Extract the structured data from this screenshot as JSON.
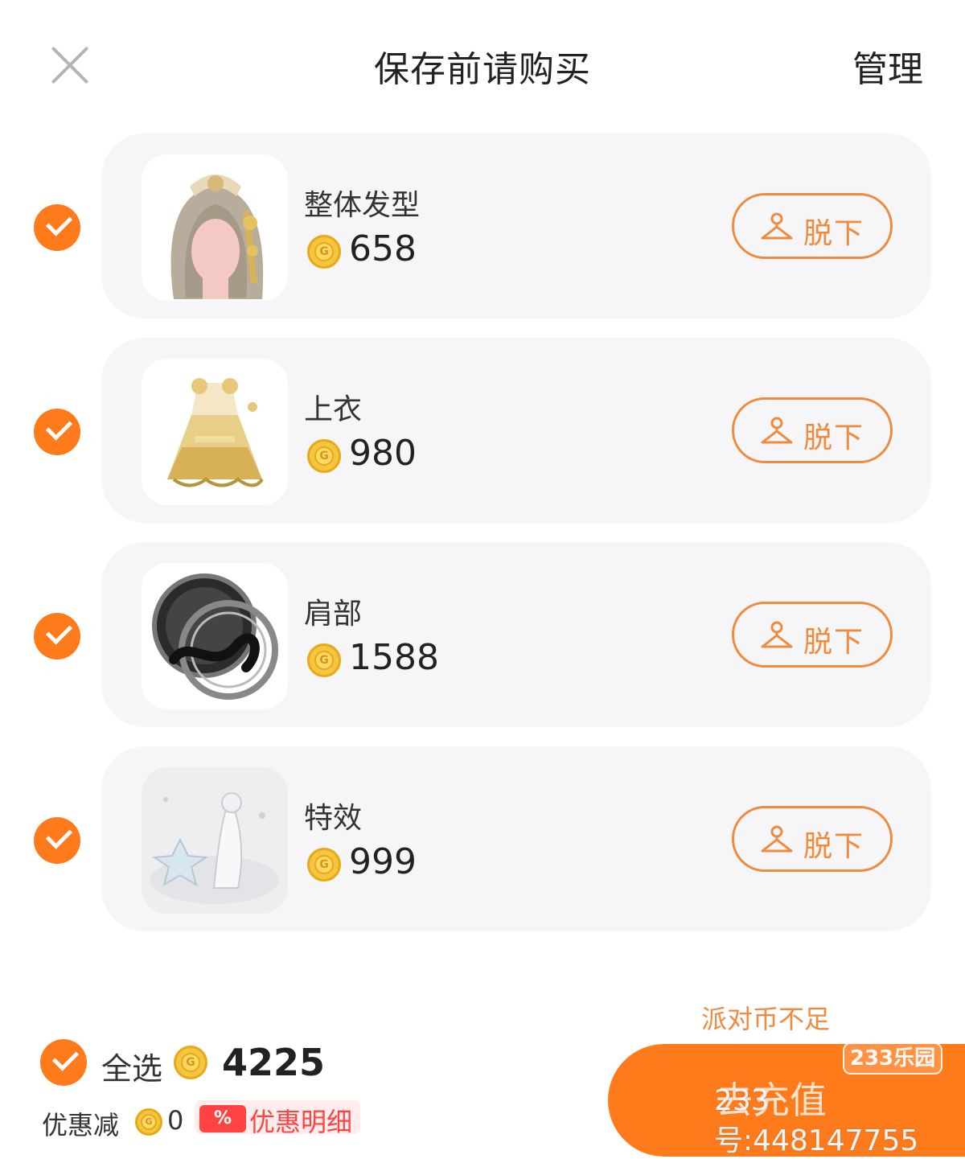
{
  "header": {
    "title": "保存前请购买",
    "manage_label": "管理"
  },
  "items": [
    {
      "name": "整体发型",
      "price": "658",
      "remove_label": "脱下",
      "checked": true
    },
    {
      "name": "上衣",
      "price": "980",
      "remove_label": "脱下",
      "checked": true
    },
    {
      "name": "肩部",
      "price": "1588",
      "remove_label": "脱下",
      "checked": true
    },
    {
      "name": "特效",
      "price": "999",
      "remove_label": "脱下",
      "checked": true
    }
  ],
  "footer": {
    "select_all_label": "全选",
    "total": "4225",
    "insufficient_text": "派对币不足",
    "discount_label": "优惠减",
    "discount_value": "0",
    "discount_tag": "%",
    "discount_detail_label": "优惠明细",
    "recharge_label": "去充值"
  },
  "watermark": {
    "badge": "233乐园",
    "text": "233号:448147755"
  },
  "colors": {
    "accent": "#ff7a1a",
    "outline": "#f08a3c",
    "card_bg": "#f6f6f8",
    "discount_red": "#ff4343"
  },
  "icons": {
    "close": "close-icon",
    "check": "check-circle-icon",
    "coin": "coin-icon",
    "hanger": "hanger-icon"
  }
}
